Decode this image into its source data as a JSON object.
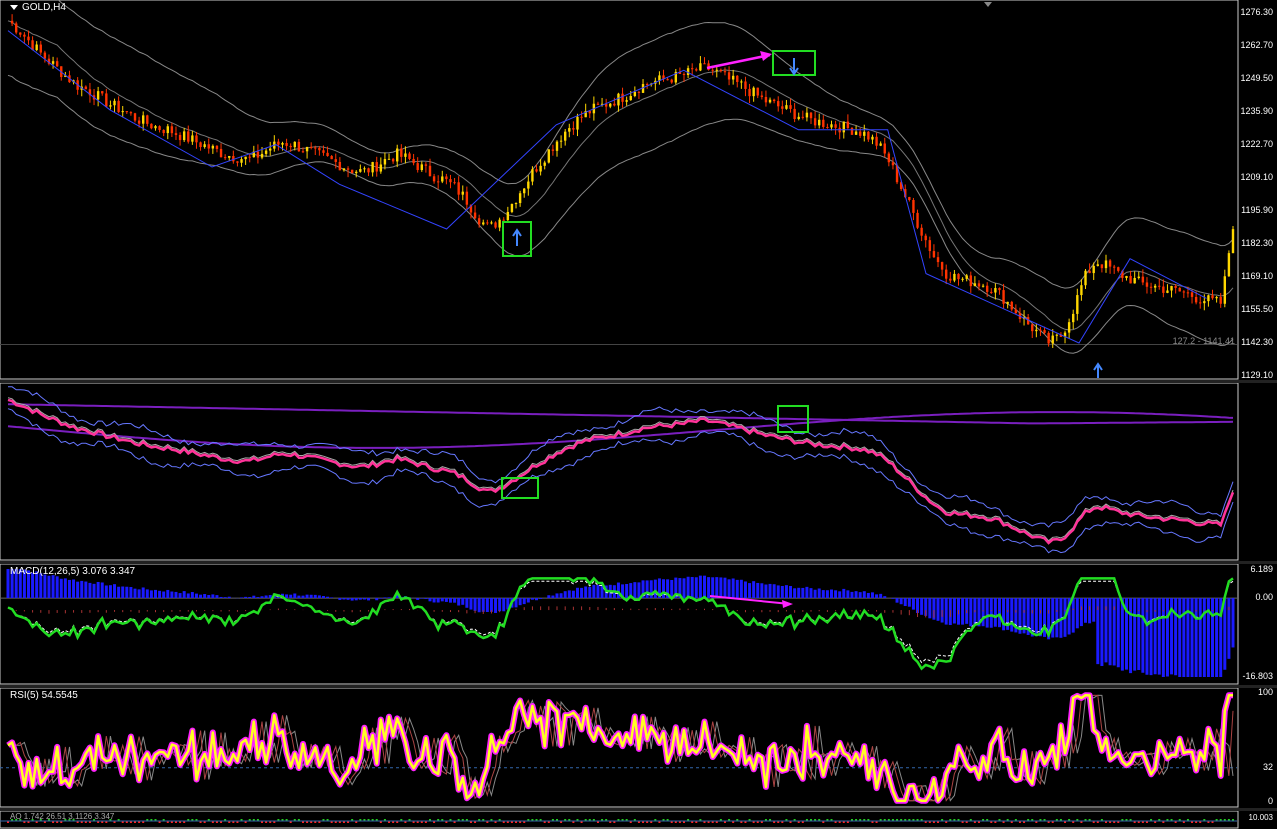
{
  "chart_title": "GOLD,H4",
  "price_axis_labels": [
    "1276.30",
    "1262.70",
    "1249.50",
    "1235.90",
    "1222.70",
    "1209.10",
    "1195.90",
    "1182.30",
    "1169.10",
    "1155.50",
    "1142.30",
    "1129.10"
  ],
  "hline_label": "127.2 - 1141.41",
  "macd_label": "MACD(12,26,5) 3.076 3.347",
  "macd_axis_labels": [
    "6.189",
    "0.00",
    "-16.803"
  ],
  "rsi_label": "RSI(5) 54.5545",
  "rsi_axis_labels": [
    "100",
    "32",
    "0"
  ],
  "bottom_label": "AO 1.742 26.51 3.1126 3.347",
  "bottom_axis_label": "10.003",
  "colors": {
    "bull": "#ffd700",
    "bear": "#ff3300",
    "zigzag": "#3344ff",
    "bands": "#888888",
    "highlight": "#22dd22",
    "arrow": "#ff22ff",
    "macd_hist": "#1a1aff",
    "macd_main": "#22dd22",
    "rsi_main": "#ffff22",
    "rsi_glow": "#ff22ff"
  },
  "chart_data": {
    "type": "candlestick",
    "title": "GOLD,H4",
    "ylim": [
      1129.1,
      1276.3
    ],
    "close_path": [
      1272,
      1268,
      1263,
      1258,
      1254,
      1250,
      1246,
      1244,
      1241,
      1238,
      1236,
      1233,
      1231,
      1229,
      1228,
      1226,
      1224,
      1222,
      1220,
      1218,
      1217,
      1216,
      1218,
      1221,
      1223,
      1222,
      1220,
      1218,
      1216,
      1214,
      1212,
      1211,
      1213,
      1216,
      1218,
      1216,
      1213,
      1210,
      1208,
      1205,
      1200,
      1193,
      1188,
      1192,
      1198,
      1205,
      1212,
      1218,
      1224,
      1229,
      1233,
      1236,
      1238,
      1240,
      1242,
      1245,
      1247,
      1248,
      1249,
      1250,
      1252,
      1253,
      1251,
      1248,
      1246,
      1243,
      1240,
      1238,
      1236,
      1234,
      1232,
      1231,
      1230,
      1229,
      1228,
      1226,
      1222,
      1215,
      1205,
      1195,
      1185,
      1176,
      1170,
      1168,
      1167,
      1166,
      1164,
      1160,
      1155,
      1150,
      1146,
      1142,
      1145,
      1155,
      1168,
      1175,
      1173,
      1170,
      1168,
      1166,
      1165,
      1164,
      1163,
      1162,
      1160,
      1159,
      1158,
      1190
    ],
    "macd_ylim": [
      -16.803,
      6.189
    ],
    "rsi_ylim": [
      0,
      100
    ],
    "rsi_level": 32
  }
}
